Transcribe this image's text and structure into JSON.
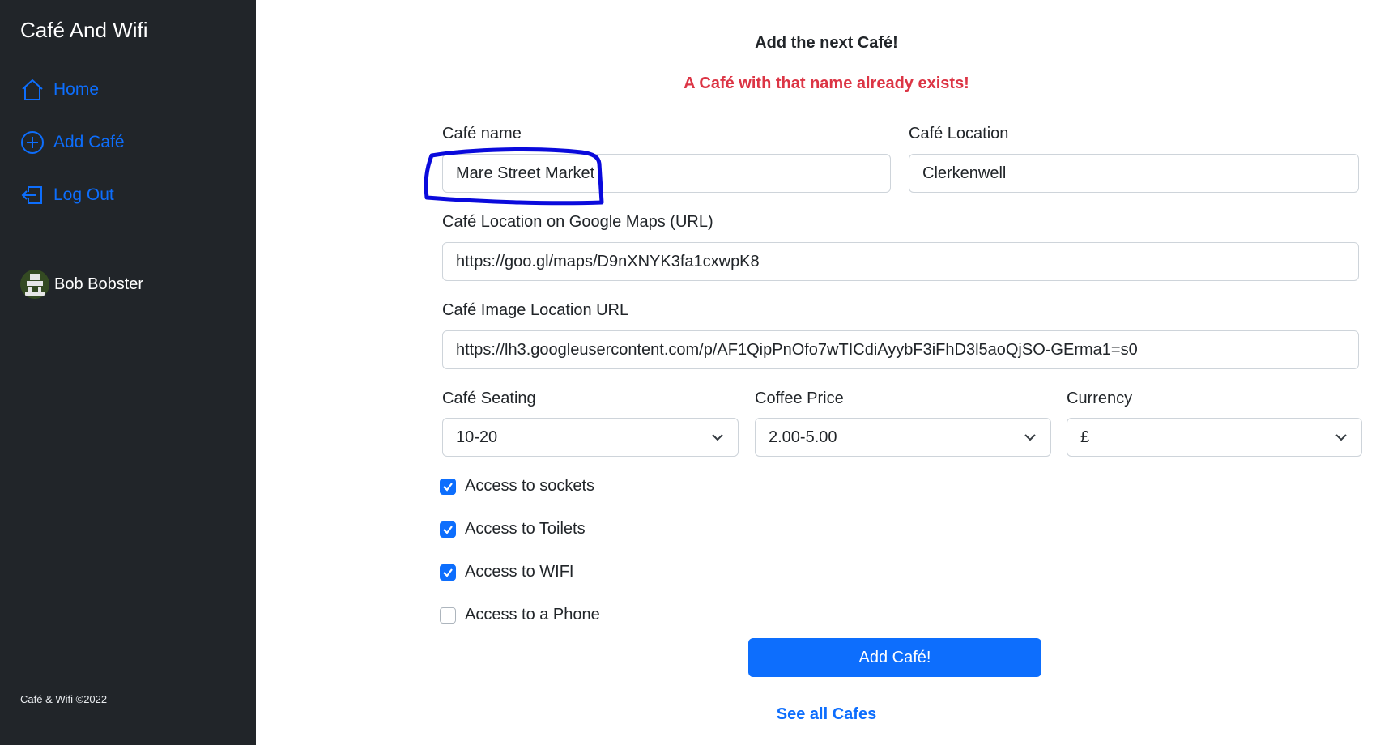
{
  "sidebar": {
    "brand": "Café And Wifi",
    "nav": [
      {
        "label": "Home",
        "icon": "house-icon"
      },
      {
        "label": "Add Café",
        "icon": "plus-circle-icon"
      },
      {
        "label": "Log Out",
        "icon": "logout-icon"
      }
    ],
    "user": {
      "name": "Bob Bobster"
    },
    "footer": "Café & Wifi ©2022"
  },
  "main": {
    "heading": "Add the next Café!",
    "error": "A Café with that name already exists!",
    "cafe_name": {
      "label": "Café name",
      "value": "Mare Street Market"
    },
    "cafe_location": {
      "label": "Café Location",
      "value": "Clerkenwell"
    },
    "maps_url": {
      "label": "Café Location on Google Maps (URL)",
      "value": "https://goo.gl/maps/D9nXNYK3fa1cxwpK8"
    },
    "image_url": {
      "label": "Café Image Location URL",
      "value": "https://lh3.googleusercontent.com/p/AF1QipPnOfo7wTICdiAyybF3iFhD3l5aoQjSO-GErma1=s0"
    },
    "seating": {
      "label": "Café Seating",
      "value": "10-20"
    },
    "price": {
      "label": "Coffee Price",
      "value": "2.00-5.00"
    },
    "currency": {
      "label": "Currency",
      "value": "£"
    },
    "checkboxes": [
      {
        "label": "Access to sockets",
        "checked": true
      },
      {
        "label": "Access to Toilets",
        "checked": true
      },
      {
        "label": "Access to WIFI",
        "checked": true
      },
      {
        "label": "Access to a Phone",
        "checked": false
      }
    ],
    "submit": "Add Café!",
    "see_all": "See all Cafes"
  },
  "colors": {
    "sidebar_bg": "#212529",
    "link": "#0d6efd",
    "error": "#dc3545",
    "highlight": "#0a0adc"
  }
}
